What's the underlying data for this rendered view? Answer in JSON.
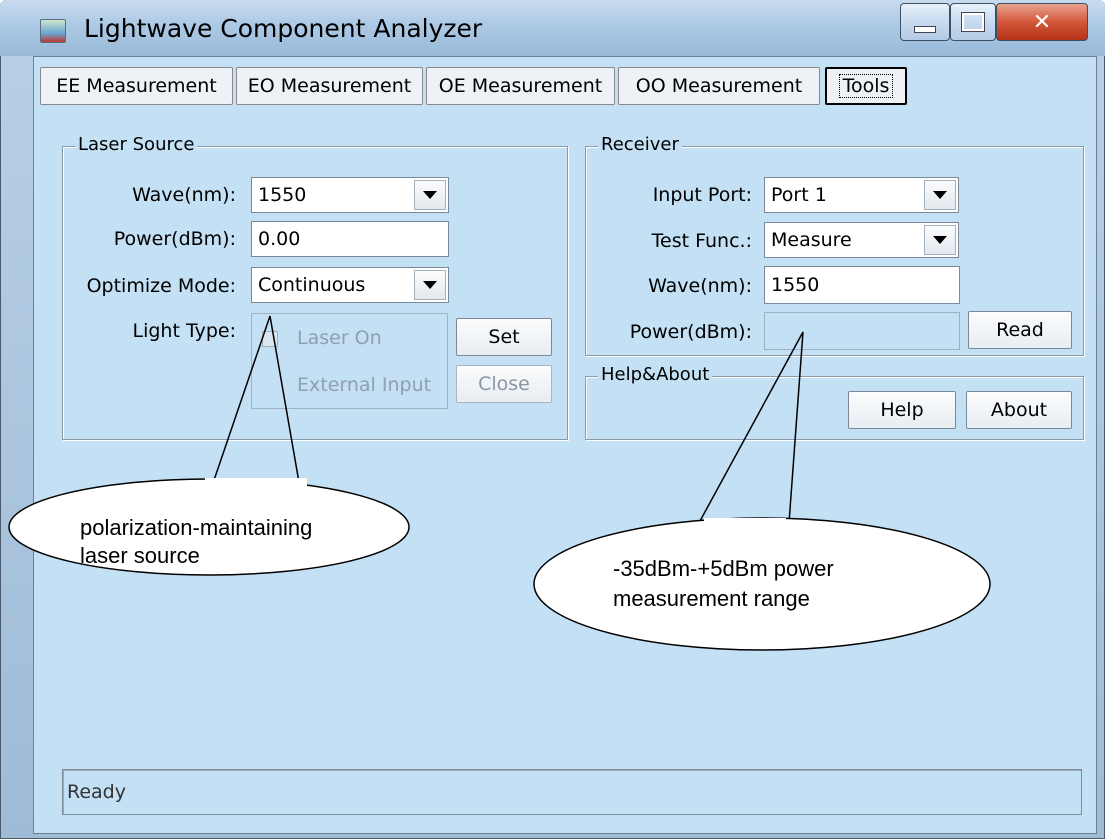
{
  "window": {
    "title": "Lightwave Component Analyzer"
  },
  "tabs": [
    {
      "label": "EE Measurement"
    },
    {
      "label": "EO Measurement"
    },
    {
      "label": "OE Measurement"
    },
    {
      "label": "OO Measurement"
    },
    {
      "label": "Tools",
      "selected": true
    }
  ],
  "laser_source": {
    "legend": "Laser Source",
    "wave_label": "Wave(nm):",
    "wave_value": "1550",
    "power_label": "Power(dBm):",
    "power_value": "0.00",
    "optimize_label": "Optimize Mode:",
    "optimize_value": "Continuous",
    "light_type_label": "Light Type:",
    "laser_on_label": "Laser On",
    "external_input_label": "External Input",
    "set_label": "Set",
    "close_label": "Close"
  },
  "receiver": {
    "legend": "Receiver",
    "input_port_label": "Input Port:",
    "input_port_value": "Port 1",
    "test_func_label": "Test Func.:",
    "test_func_value": "Measure",
    "wave_label": "Wave(nm):",
    "wave_value": "1550",
    "power_label": "Power(dBm):",
    "power_value": "",
    "read_label": "Read"
  },
  "help_about": {
    "legend": "Help&About",
    "help_label": "Help",
    "about_label": "About"
  },
  "statusbar": {
    "text": "Ready"
  },
  "callouts": {
    "left_line1": "polarization-maintaining",
    "left_line2": "laser source",
    "right_line1": "-35dBm-+5dBm power",
    "right_line2": "measurement range"
  },
  "colors": {
    "client_background": "#c3e0f4",
    "close_button": "#d2573b"
  }
}
